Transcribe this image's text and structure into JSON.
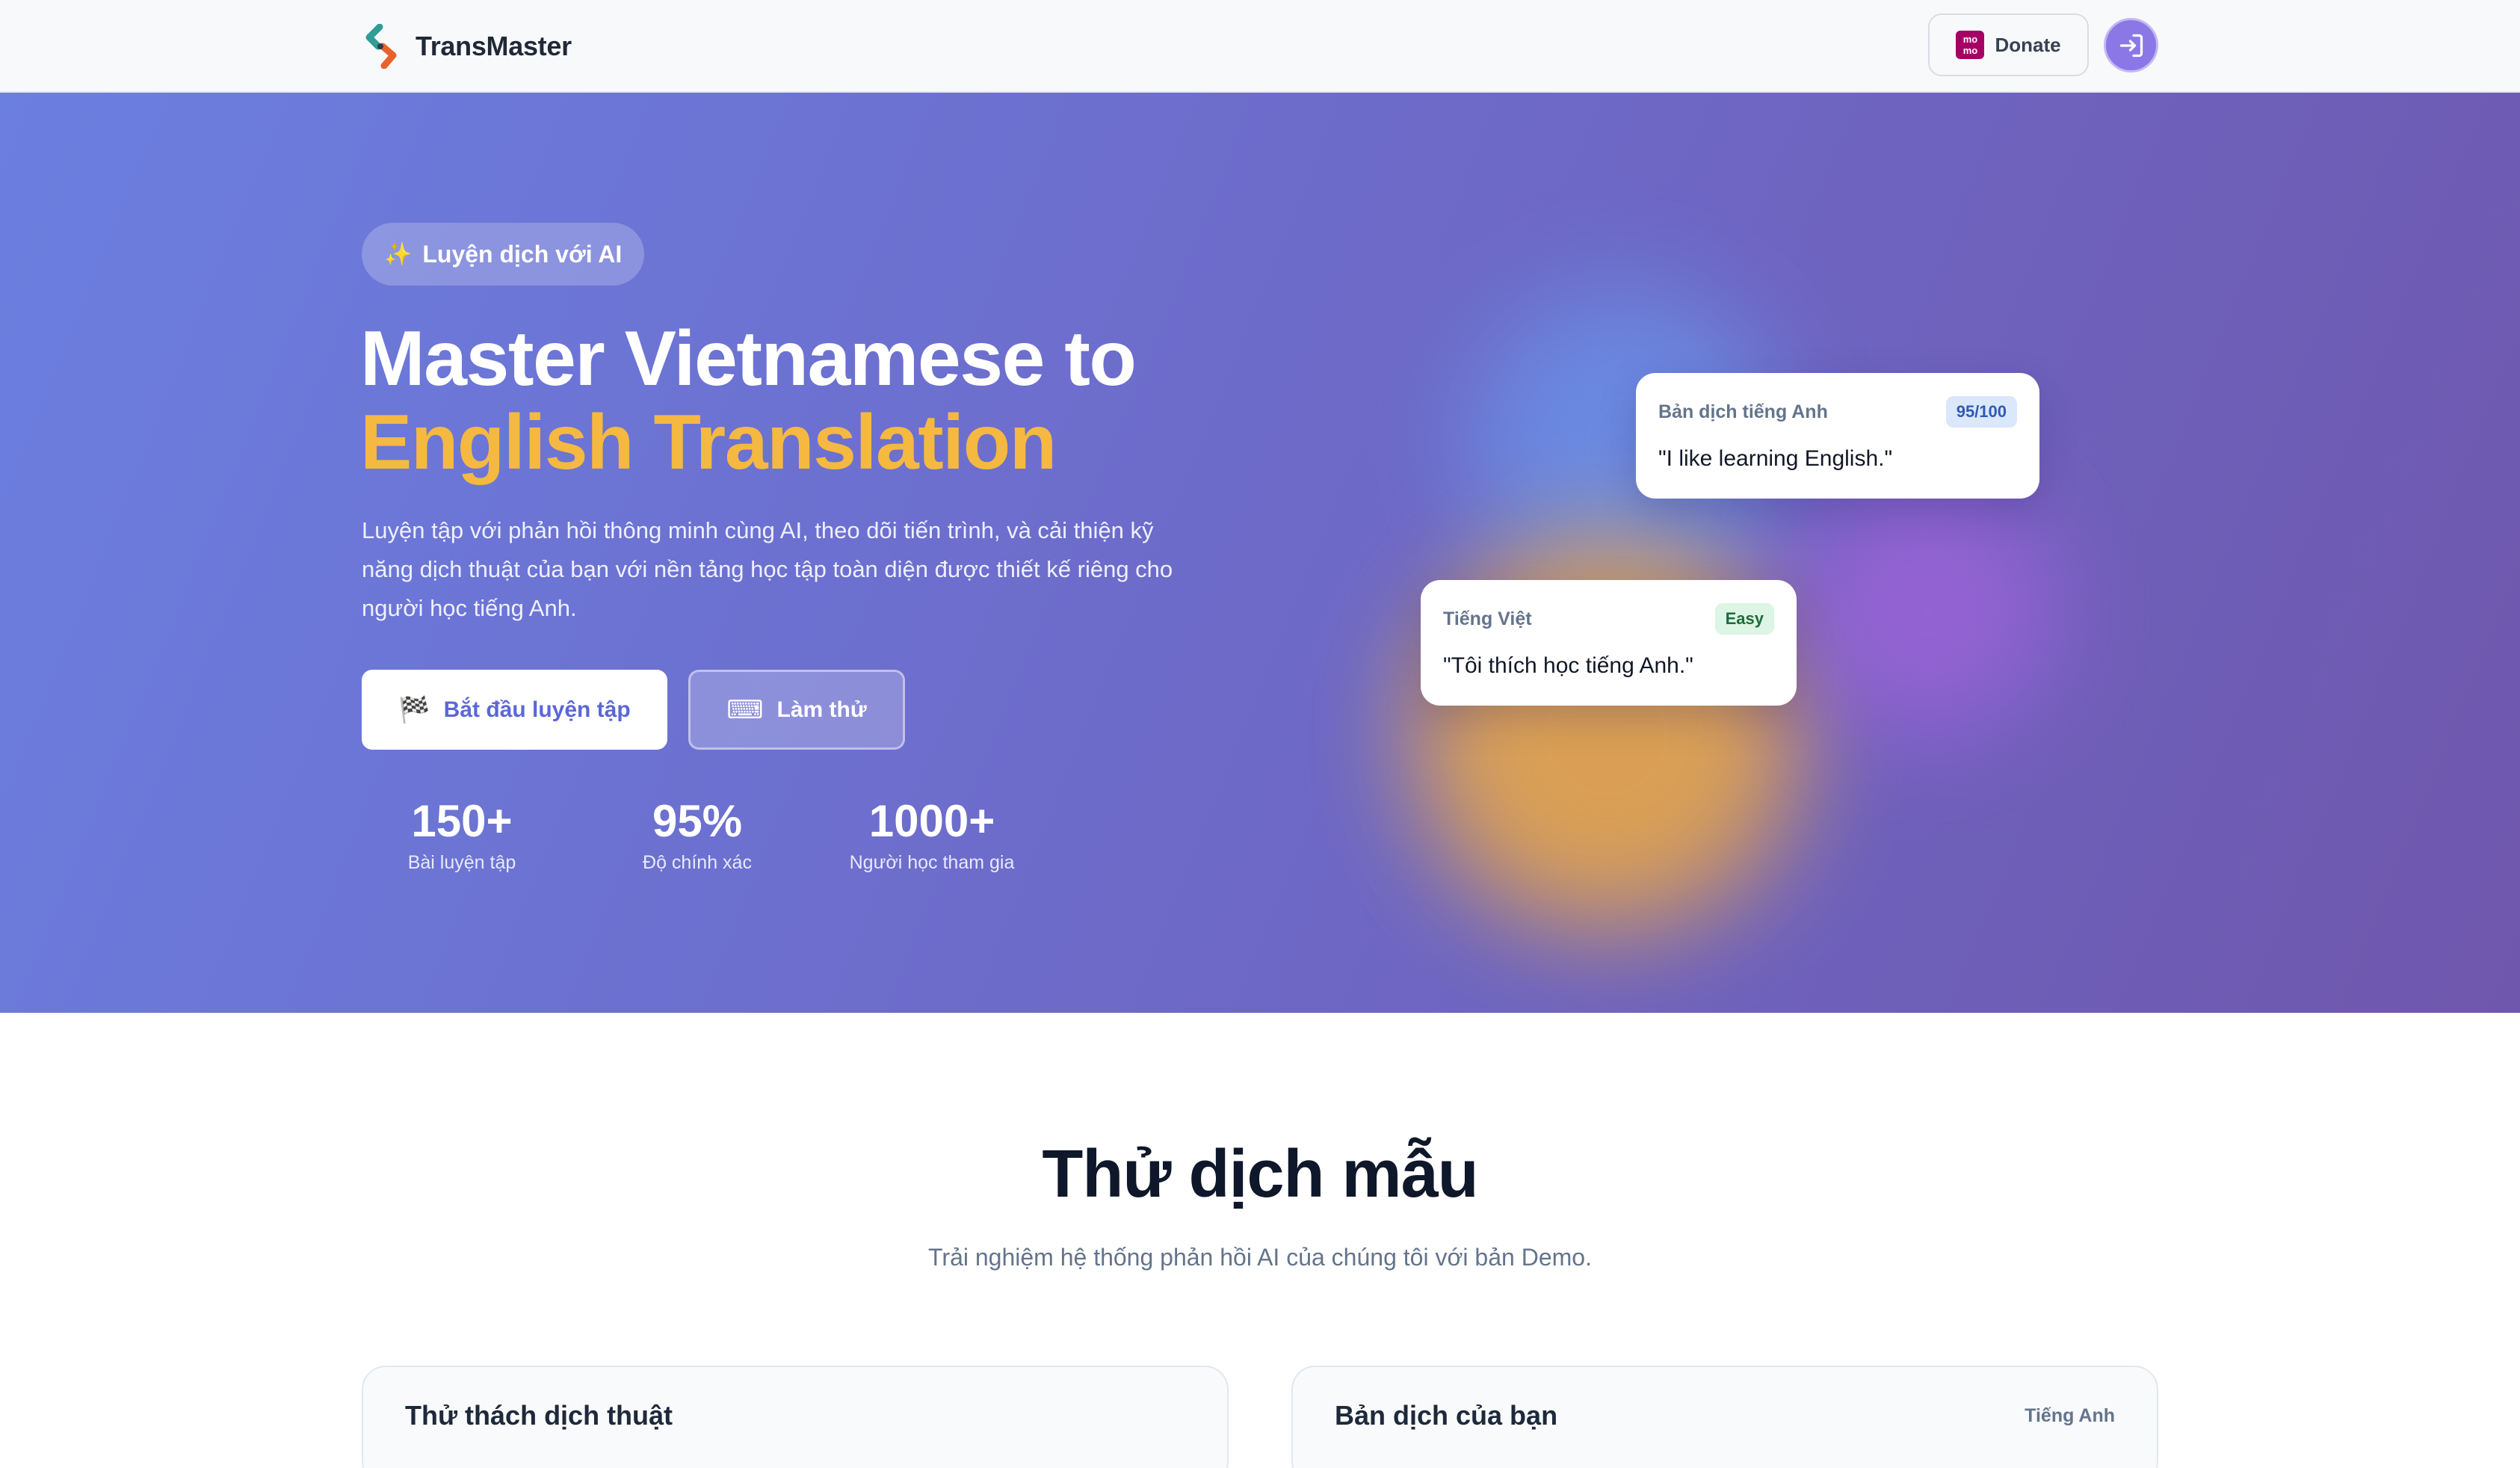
{
  "header": {
    "brand": "TransMaster",
    "donate_label": "Donate",
    "momo_text_top": "mo",
    "momo_text_bottom": "mo",
    "login_icon": "login-icon"
  },
  "hero": {
    "chip_label": "Luyện dịch với AI",
    "chip_icon": "sparkles-icon",
    "title_line1": "Master Vietnamese to",
    "title_line2": "English Translation",
    "description": "Luyện tập với phản hồi thông minh cùng AI, theo dõi tiến trình, và cải thiện kỹ năng dịch thuật của bạn với nền tảng học tập toàn diện được thiết kế riêng cho người học tiếng Anh.",
    "primary_button": {
      "label": "Bắt đầu luyện tập",
      "icon": "checkered-flag-icon"
    },
    "secondary_button": {
      "label": "Làm thử",
      "icon": "keyboard-icon"
    },
    "stats": [
      {
        "value": "150+",
        "label": "Bài luyện tập"
      },
      {
        "value": "95%",
        "label": "Độ chính xác"
      },
      {
        "value": "1000+",
        "label": "Người học tham gia"
      }
    ],
    "card_english": {
      "label": "Bản dịch tiếng Anh",
      "badge": "95/100",
      "text": "\"I like learning English.\""
    },
    "card_vietnamese": {
      "label": "Tiếng Việt",
      "badge": "Easy",
      "text": "\"Tôi thích học tiếng Anh.\""
    }
  },
  "demo": {
    "title": "Thử dịch mẫu",
    "subtitle": "Trải nghiệm hệ thống phản hồi AI của chúng tôi với bản Demo.",
    "left_panel_title": "Thử thách dịch thuật",
    "right_panel_title": "Bản dịch của bạn",
    "right_panel_meta": "Tiếng Anh"
  },
  "colors": {
    "accent_yellow": "#f5b841",
    "primary_text_button": "#5b67d8",
    "login_button": "#8b78e6",
    "momo_brand": "#a50064"
  }
}
